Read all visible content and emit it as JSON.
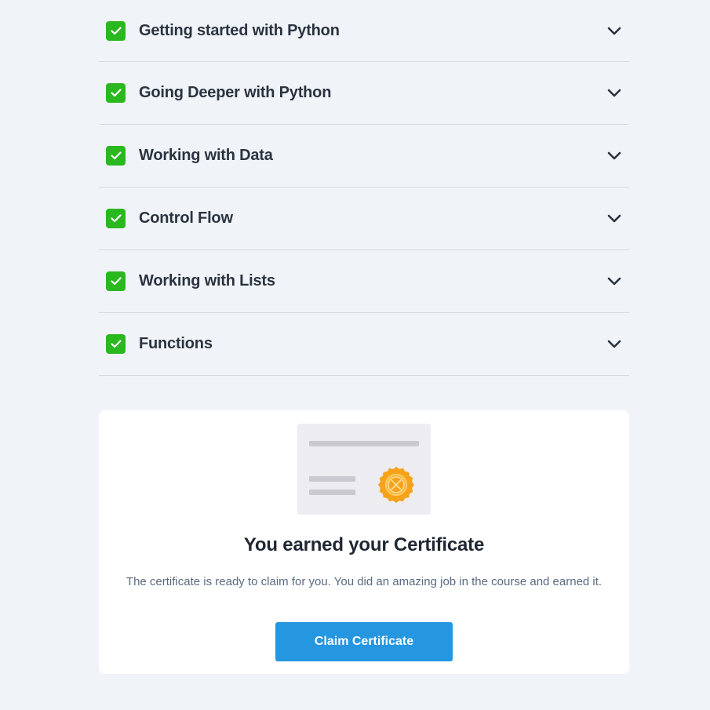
{
  "sections": [
    {
      "title": "Getting started with Python",
      "completed": true
    },
    {
      "title": "Going Deeper with Python",
      "completed": true
    },
    {
      "title": "Working with Data",
      "completed": true
    },
    {
      "title": "Control Flow",
      "completed": true
    },
    {
      "title": "Working with Lists",
      "completed": true
    },
    {
      "title": "Functions",
      "completed": true
    }
  ],
  "icons": {
    "check": "check-icon",
    "chevron": "chevron-down-icon",
    "seal": "certificate-seal-icon"
  },
  "colors": {
    "check_bg": "#2ab81f",
    "button_bg": "#2596e0",
    "seal": "#f7a21b"
  },
  "certificate": {
    "title": "You earned your Certificate",
    "description": "The certificate is ready to claim for you. You did an amazing job in the course and earned it.",
    "button_label": "Claim Certificate"
  }
}
